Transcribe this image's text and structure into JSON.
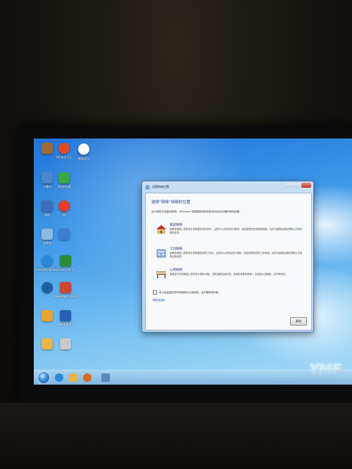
{
  "desktop": {
    "icons": [
      {
        "name": "recycle-bin",
        "label": "",
        "color": "#9b6b3a"
      },
      {
        "name": "qihoo-safe",
        "label": "360安全卫士",
        "color": "#e04a2a"
      },
      {
        "name": "kuwo",
        "label": "酷我音乐",
        "color": "#ffffff"
      },
      {
        "name": "computer",
        "label": "计算机",
        "color": "#4a86c9"
      },
      {
        "name": "qihoo-browser",
        "label": "360浏览器",
        "color": "#3aa845"
      },
      {
        "name": "network",
        "label": "网络",
        "color": "#3d6fb8"
      },
      {
        "name": "qq",
        "label": "QQ",
        "color": "#e83b2a"
      },
      {
        "name": "recycle",
        "label": "回收站",
        "color": "#8fb8e0"
      },
      {
        "name": "plane",
        "label": "",
        "color": "#3f7fcf"
      },
      {
        "name": "ie",
        "label": "Internet Explorer",
        "color": "#2a89d8"
      },
      {
        "name": "excel",
        "label": "Excel 2003",
        "color": "#2f8a3a"
      },
      {
        "name": "player",
        "label": "",
        "color": "#1b5fa6"
      },
      {
        "name": "powerpoint",
        "label": "PowerPoint 2003",
        "color": "#d0452d"
      },
      {
        "name": "book",
        "label": "",
        "color": "#e3a52b"
      },
      {
        "name": "word",
        "label": "Word 2003",
        "color": "#2b5eb7"
      },
      {
        "name": "folder",
        "label": "",
        "color": "#e6b54a"
      },
      {
        "name": "tool",
        "label": "",
        "color": "#c9c9c9"
      }
    ]
  },
  "dialog": {
    "window_title": "设置网络位置",
    "heading": "选择“网络”网络的位置",
    "description": "此计算机已连接到网络。Windows 将根据网络的类型自动应用正确的网络设置。",
    "options": [
      {
        "title": "家庭网络",
        "desc": "如果此网络上的所有计算机都在您的家中，且您可以识别这些计算机，则这是受信任的家庭网络。请勿为咖啡店或机场等公共场所选择此项。",
        "icon": "home-icon"
      },
      {
        "title": "工作网络",
        "desc": "如果此网络上的所有计算机都在您的工作区，且您可以识别这些计算机，则这是受信任的工作网络。请勿为咖啡店或机场等公共场所选择此项。",
        "icon": "office-icon"
      },
      {
        "title": "公用网络",
        "desc": "如果您不识别网络上的所有计算机(例如，您在咖啡店或机场，或者您有移动宽带)，则这是公用网络，且不受信任。",
        "icon": "bench-icon"
      }
    ],
    "checkbox_label": "将以后连接的所有网络视为公用网络，且不要再询问我。",
    "help_link": "帮助我选择",
    "cancel_label": "取消"
  },
  "brand_logo": "YMF",
  "colors": {
    "accent": "#1e3f8a",
    "link": "#2258b8",
    "close": "#c2321f"
  }
}
